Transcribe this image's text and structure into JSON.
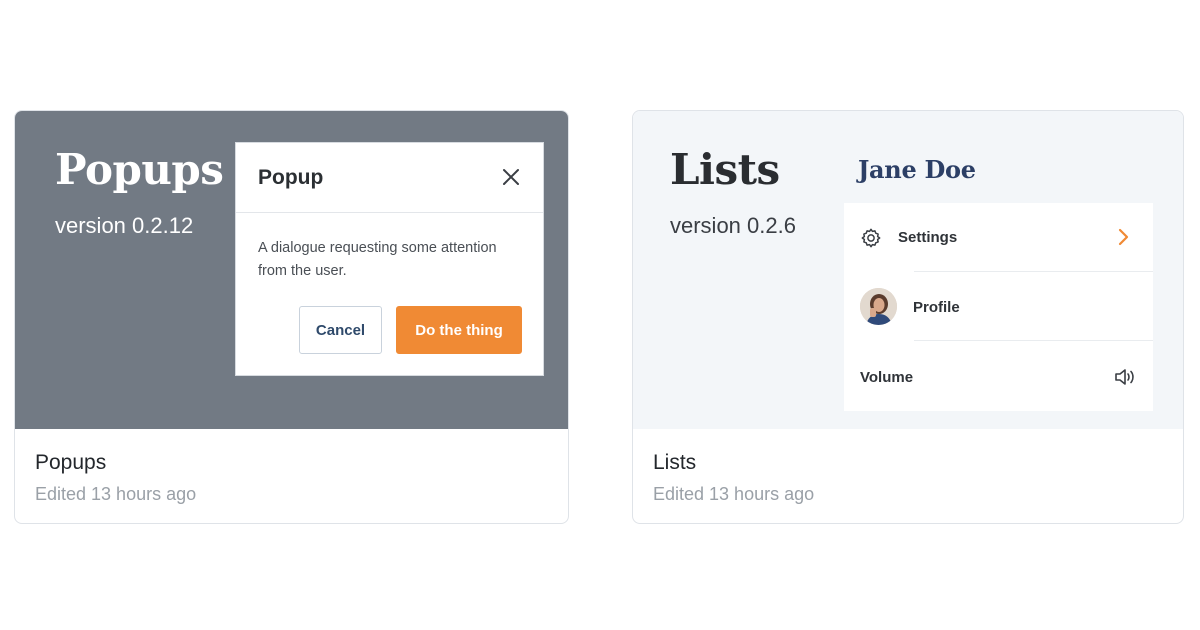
{
  "cards": [
    {
      "title": "Popups",
      "edited": "Edited 13 hours ago",
      "preview": {
        "heading": "Popups",
        "version": "version 0.2.12",
        "popup": {
          "title": "Popup",
          "body": "A dialogue requesting some attention from the user.",
          "cancel_label": "Cancel",
          "primary_label": "Do the thing",
          "close_icon": "close-icon"
        }
      }
    },
    {
      "title": "Lists",
      "edited": "Edited 13 hours ago",
      "preview": {
        "heading": "Lists",
        "version": "version 0.2.6",
        "user_name": "Jane Doe",
        "items": [
          {
            "label": "Settings",
            "icon": "gear-icon",
            "trailing": "chevron-right-icon"
          },
          {
            "label": "Profile",
            "icon": "avatar"
          },
          {
            "label": "Volume",
            "trailing": "speaker-icon"
          }
        ]
      }
    }
  ],
  "colors": {
    "primary_button": "#f08a34",
    "preview_dark": "#727a84",
    "preview_light": "#f3f6f9",
    "name_navy": "#2c3f66"
  }
}
